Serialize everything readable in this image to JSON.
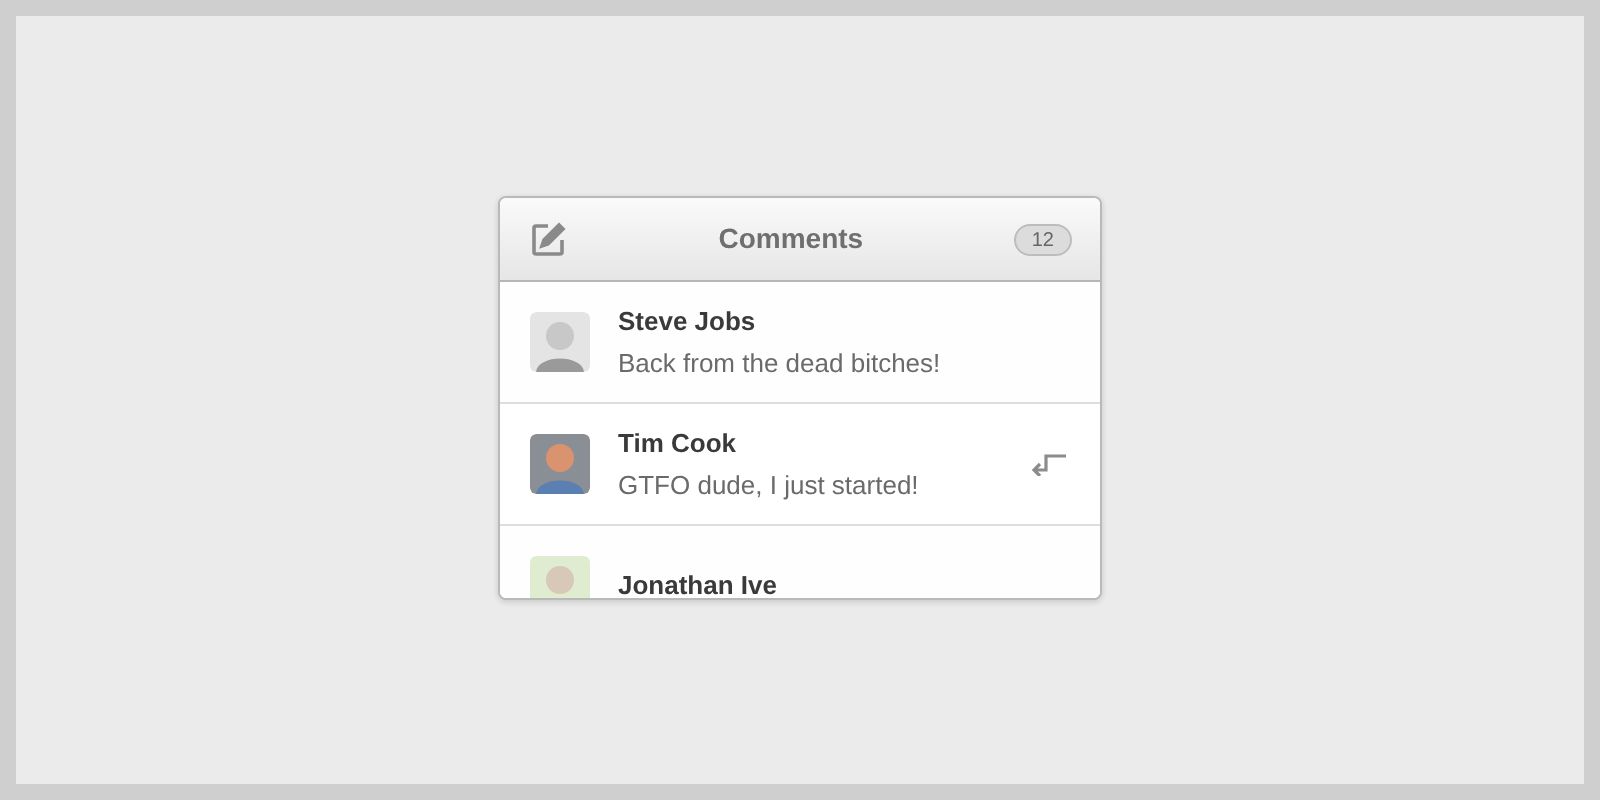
{
  "header": {
    "title": "Comments",
    "count": "12"
  },
  "comments": [
    {
      "author": "Steve Jobs",
      "message": "Back from the dead bitches!",
      "reply_shown": false
    },
    {
      "author": "Tim Cook",
      "message": "GTFO dude, I just started!",
      "reply_shown": true
    },
    {
      "author": "Jonathan Ive",
      "reply_shown": false
    }
  ]
}
